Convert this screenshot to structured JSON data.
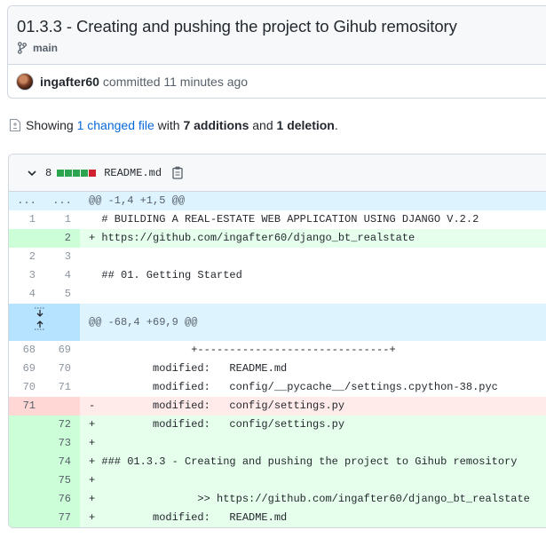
{
  "commit": {
    "title": "01.3.3 - Creating and pushing the project to Gihub remository",
    "branch": "main",
    "author": "ingafter60",
    "committed_text": "committed 11 minutes ago"
  },
  "summary": {
    "showing": "Showing",
    "changed_link": "1 changed file",
    "with": "with",
    "additions": "7 additions",
    "and": "and",
    "deletions": "1 deletion",
    "period": "."
  },
  "file": {
    "changes_count": "8",
    "name": "README.md",
    "diffstat": [
      "add",
      "add",
      "add",
      "add",
      "del"
    ],
    "colors": {
      "add": "#2da44e",
      "del": "#cf222e",
      "neutral": "#d0d7de"
    }
  },
  "diff": {
    "hunk1": {
      "left": "...",
      "right": "...",
      "header": "@@ -1,4 +1,5 @@"
    },
    "hunk2": {
      "header": "@@ -68,4 +69,9 @@"
    },
    "rows": [
      {
        "type": "ctx",
        "old": "1",
        "new": "1",
        "text": "  # BUILDING A REAL-ESTATE WEB APPLICATION USING DJANGO V.2.2"
      },
      {
        "type": "add",
        "old": "",
        "new": "2",
        "text": "+ https://github.com/ingafter60/django_bt_realstate"
      },
      {
        "type": "ctx",
        "old": "2",
        "new": "3",
        "text": ""
      },
      {
        "type": "ctx",
        "old": "3",
        "new": "4",
        "text": "  ## 01. Getting Started"
      },
      {
        "type": "ctx",
        "old": "4",
        "new": "5",
        "text": ""
      },
      {
        "type": "ctx",
        "old": "68",
        "new": "69",
        "text": "                +------------------------------+"
      },
      {
        "type": "ctx",
        "old": "69",
        "new": "70",
        "text": "          modified:   README.md"
      },
      {
        "type": "ctx",
        "old": "70",
        "new": "71",
        "text": "          modified:   config/__pycache__/settings.cpython-38.pyc"
      },
      {
        "type": "del",
        "old": "71",
        "new": "",
        "text": "-         modified:   config/settings.py"
      },
      {
        "type": "add",
        "old": "",
        "new": "72",
        "text": "+         modified:   config/settings.py"
      },
      {
        "type": "add",
        "old": "",
        "new": "73",
        "text": "+"
      },
      {
        "type": "add",
        "old": "",
        "new": "74",
        "text": "+ ### 01.3.3 - Creating and pushing the project to Gihub remository"
      },
      {
        "type": "add",
        "old": "",
        "new": "75",
        "text": "+"
      },
      {
        "type": "add",
        "old": "",
        "new": "76",
        "text": "+                >> https://github.com/ingafter60/django_bt_realstate"
      },
      {
        "type": "add",
        "old": "",
        "new": "77",
        "text": "+         modified:   README.md"
      }
    ]
  }
}
